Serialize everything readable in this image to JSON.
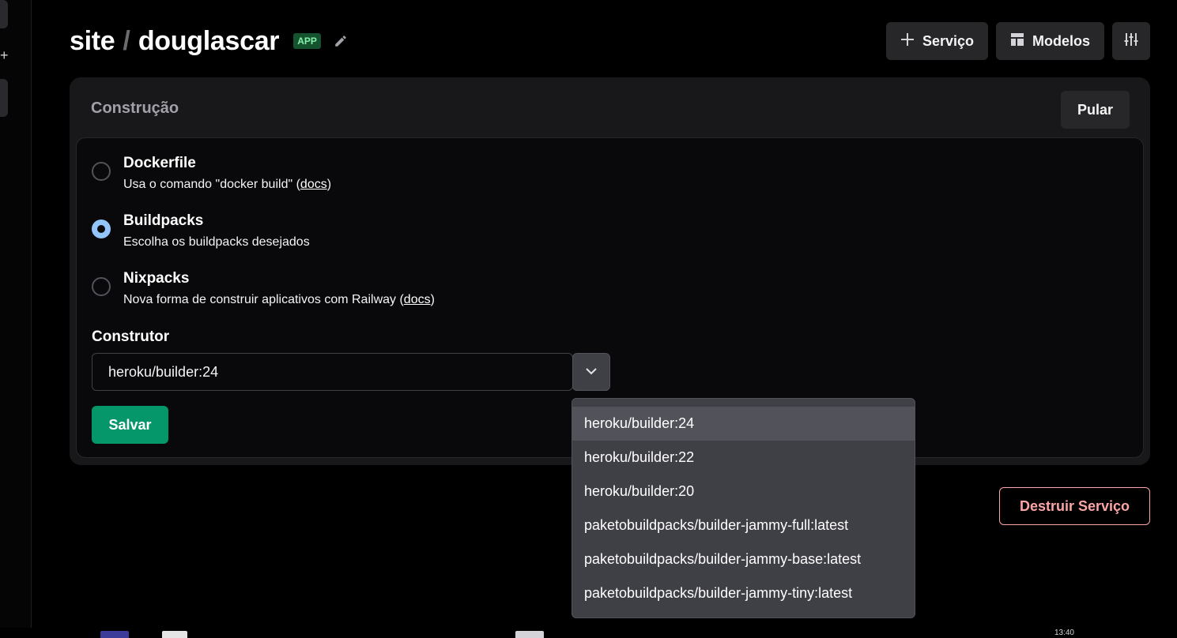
{
  "header": {
    "project": "site",
    "separator": "/",
    "service": "douglascar",
    "badge": "APP",
    "actions": {
      "service_label": "Serviço",
      "templates_label": "Modelos"
    }
  },
  "build": {
    "section_title": "Construção",
    "skip_label": "Pular",
    "options": [
      {
        "title": "Dockerfile",
        "desc_prefix": "Usa o comando \"docker build\" (",
        "link": "docs",
        "desc_suffix": ")",
        "selected": false
      },
      {
        "title": "Buildpacks",
        "desc": "Escolha os buildpacks desejados",
        "selected": true
      },
      {
        "title": "Nixpacks",
        "desc_prefix": "Nova forma de construir aplicativos com Railway (",
        "link": "docs",
        "desc_suffix": ")",
        "selected": false
      }
    ],
    "builder_label": "Construtor",
    "builder_value": "heroku/builder:24",
    "save_label": "Salvar"
  },
  "builder_dropdown": {
    "options": [
      "heroku/builder:24",
      "heroku/builder:22",
      "heroku/builder:20",
      "paketobuildpacks/builder-jammy-full:latest",
      "paketobuildpacks/builder-jammy-base:latest",
      "paketobuildpacks/builder-jammy-tiny:latest"
    ],
    "highlighted_index": 0
  },
  "danger": {
    "destroy_label": "Destruir Serviço"
  },
  "taskbar": {
    "clock": "13:40"
  },
  "colors": {
    "accent_save": "#059669",
    "radio_selected": "#93c5fd",
    "danger": "#fca5a5",
    "badge_bg": "#14532d",
    "badge_text": "#86efac"
  }
}
